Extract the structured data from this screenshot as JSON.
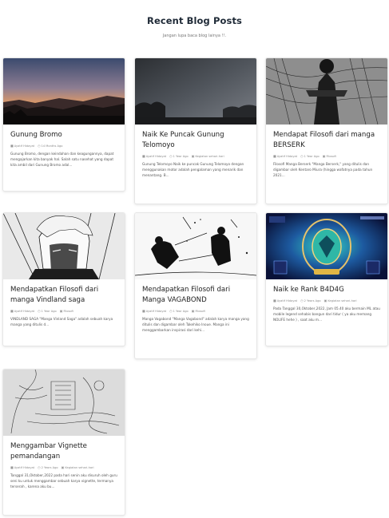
{
  "header": {
    "title": "Recent Blog Posts",
    "subtitle": "Jangan lupa baca blog lainya !!."
  },
  "posts": [
    {
      "title": "Gunung Bromo",
      "author": "Ayatif Hidayat",
      "date": "14 Months Ago",
      "category": "",
      "excerpt": "Gunung Bromo, dengan keindahan dan keagungannya, dapat mengajarkan kita banyak hal. Salah satu nasehat yang dapat kita ambil dari Gunung Bromo adal..."
    },
    {
      "title": "Naik Ke Puncak Gunung Telomoyo",
      "author": "Ayatif Hidayat",
      "date": "1 Year Ago",
      "category": "Kegiatan sehari-hari",
      "excerpt": "Gunung Telomoyo Naik ke puncak Gunung Telomoyo dengan menggunakan motor adalah pengalaman yang menarik dan menantang. B..."
    },
    {
      "title": "Mendapat Filosofi dari manga BERSERK",
      "author": "Ayatif Hidayat",
      "date": "1 Year Ago",
      "category": "Filosofi",
      "excerpt": "Filosofi Manga Berserk \"Manga Berserk,\" yang ditulis dan digambar oleh Kentaro Miura (hingga wafatnya pada tahun 2021..."
    },
    {
      "title": "Mendapatkan Filosofi dari manga Vindland saga",
      "author": "Ayatif Hidayat",
      "date": "1 Year Ago",
      "category": "Filosofi",
      "excerpt": "VINDLAND SAGA \"Manga Vinland Saga\" adalah sebuah karya manga yang ditulis d..."
    },
    {
      "title": "Mendapatkan Filosofi dari Manga VAGABOND",
      "author": "Ayatif Hidayat",
      "date": "1 Year Ago",
      "category": "Filosofi",
      "excerpt": "Manga Vagabond \"Manga Vagabond\" adalah karya manga yang ditulis dan digambar oleh Takehiko Inoue. Manga ini menggambarkan inspirasi dari kehi..."
    },
    {
      "title": "Naik ke Rank B4D4G",
      "author": "Ayatif Hidayat",
      "date": "2 Years Ago",
      "category": "Kegiatan sehari-hari",
      "excerpt": "Pada Tanggal 30,Oktober,2022, Jam 05.40 aku bermain ML atau mobile legend sehabis bangun dari tidur ( ya aku memang NOLIFE hehe ) , saat aku m..."
    },
    {
      "title": "Menggambar Vignette pemandangan",
      "author": "Ayatif Hidayat",
      "date": "2 Years Ago",
      "category": "Kegiatan sehari-hari",
      "excerpt": "Tanggal 31,Oktober,2022 pada hari senin aku disuruh oleh guru seni ku untuk menggambar sebuah karya vignette, termanya terserah , karena aku bu..."
    }
  ],
  "icons": {
    "author": "user-icon",
    "date": "clock-icon",
    "category": "folder-icon"
  }
}
